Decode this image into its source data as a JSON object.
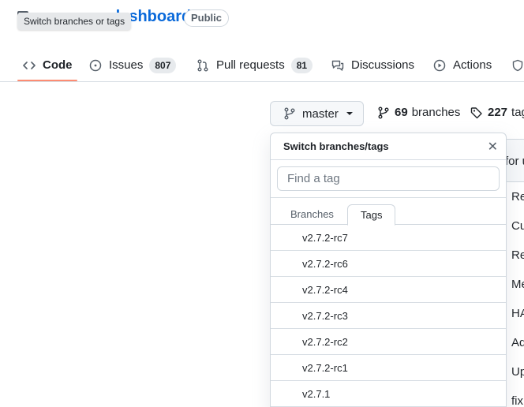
{
  "repo": {
    "name": "dashboard",
    "visibility": "Public"
  },
  "tooltip": "Switch branches or tags",
  "nav": {
    "code": "Code",
    "issues": "Issues",
    "issues_count": "807",
    "pulls": "Pull requests",
    "pulls_count": "81",
    "discussions": "Discussions",
    "actions": "Actions"
  },
  "branch_button": {
    "label": "master"
  },
  "meta": {
    "branches_count": "69",
    "branches_label": "branches",
    "tags_count": "227",
    "tags_label": "tag"
  },
  "file_rows": [
    "for u",
    "Re",
    "Cu",
    "Re",
    "Me",
    "HA",
    "Ad",
    "Up",
    "fix"
  ],
  "dropdown": {
    "title": "Switch branches/tags",
    "close_glyph": "✕",
    "filter_placeholder": "Find a tag",
    "tab_branches": "Branches",
    "tab_tags": "Tags",
    "tags": [
      "v2.7.2-rc7",
      "v2.7.2-rc6",
      "v2.7.2-rc4",
      "v2.7.2-rc3",
      "v2.7.2-rc2",
      "v2.7.2-rc1",
      "v2.7.1"
    ]
  }
}
